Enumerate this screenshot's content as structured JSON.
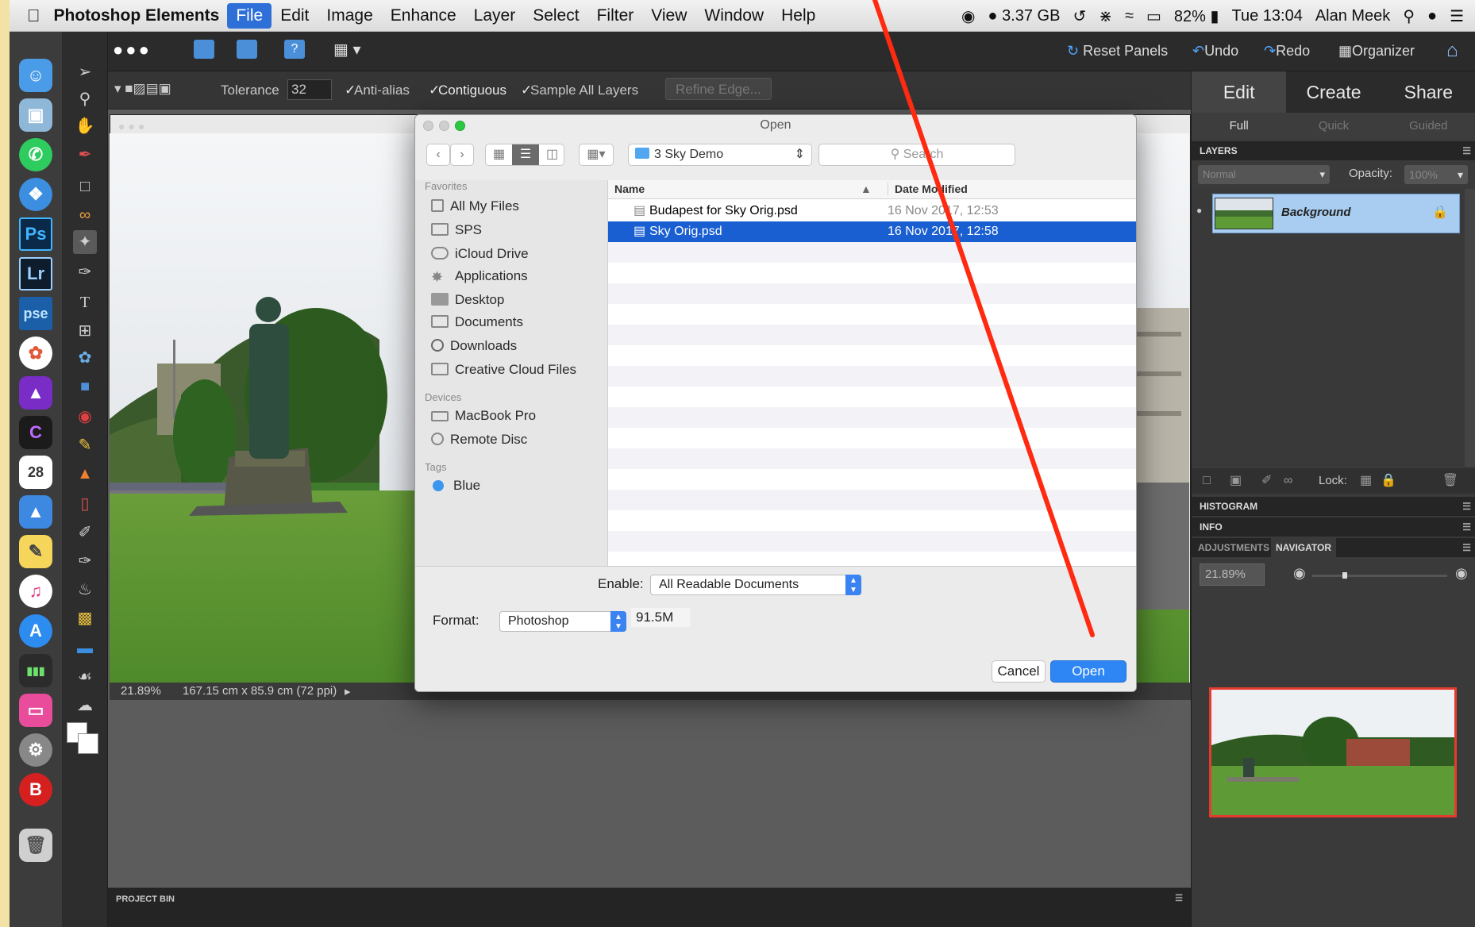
{
  "menubar": {
    "app_name": "Photoshop Elements",
    "items": [
      "File",
      "Edit",
      "Image",
      "Enhance",
      "Layer",
      "Select",
      "Filter",
      "View",
      "Window",
      "Help"
    ],
    "active_item": "File",
    "memory": "3.37 GB",
    "battery": "82%",
    "clock": "Tue 13:04",
    "user": "Alan Meek"
  },
  "topbar": {
    "reset_panels": "Reset Panels",
    "undo": "Undo",
    "redo": "Redo",
    "organizer": "Organizer"
  },
  "options_bar": {
    "tolerance_label": "Tolerance",
    "tolerance_value": "32",
    "anti_alias": "Anti-alias",
    "contiguous": "Contiguous",
    "sample_all_layers": "Sample All Layers",
    "refine_edge": "Refine Edge..."
  },
  "document": {
    "zoom": "21.89%",
    "dimensions": "167.15 cm x 85.9 cm (72 ppi)"
  },
  "project_bin": {
    "label": "PROJECT BIN"
  },
  "panels": {
    "mode_tabs": [
      "Edit",
      "Create",
      "Share"
    ],
    "edit_tabs": [
      "Full",
      "Quick",
      "Guided"
    ],
    "layers_header": "LAYERS",
    "blend_mode": "Normal",
    "opacity_label": "Opacity:",
    "opacity_value": "100%",
    "layer_name": "Background",
    "lock_label": "Lock:",
    "histogram_header": "HISTOGRAM",
    "info_header": "INFO",
    "adjustments_tab": "ADJUSTMENTS",
    "navigator_tab": "NAVIGATOR",
    "nav_zoom": "21.89%"
  },
  "dialog": {
    "title": "Open",
    "location": "3 Sky Demo",
    "search_placeholder": "Search",
    "favorites_header": "Favorites",
    "favorites": [
      "All My Files",
      "SPS",
      "iCloud Drive",
      "Applications",
      "Desktop",
      "Documents",
      "Downloads",
      "Creative Cloud Files"
    ],
    "devices_header": "Devices",
    "devices": [
      "MacBook Pro",
      "Remote Disc"
    ],
    "tags_header": "Tags",
    "tags": [
      "Blue"
    ],
    "columns": {
      "name": "Name",
      "date": "Date Modified"
    },
    "files": [
      {
        "name": "Budapest for Sky Orig.psd",
        "date": "16 Nov 2017, 12:53",
        "selected": false
      },
      {
        "name": "Sky Orig.psd",
        "date": "16 Nov 2017, 12:58",
        "selected": true
      }
    ],
    "enable_label": "Enable:",
    "enable_value": "All Readable Documents",
    "format_label": "Format:",
    "format_value": "Photoshop",
    "file_size": "91.5M",
    "cancel": "Cancel",
    "open": "Open"
  },
  "colors": {
    "accent": "#1a5fd1",
    "annotation_arrow": "#ff2a10",
    "desktop_border": "#f3e2a6"
  }
}
